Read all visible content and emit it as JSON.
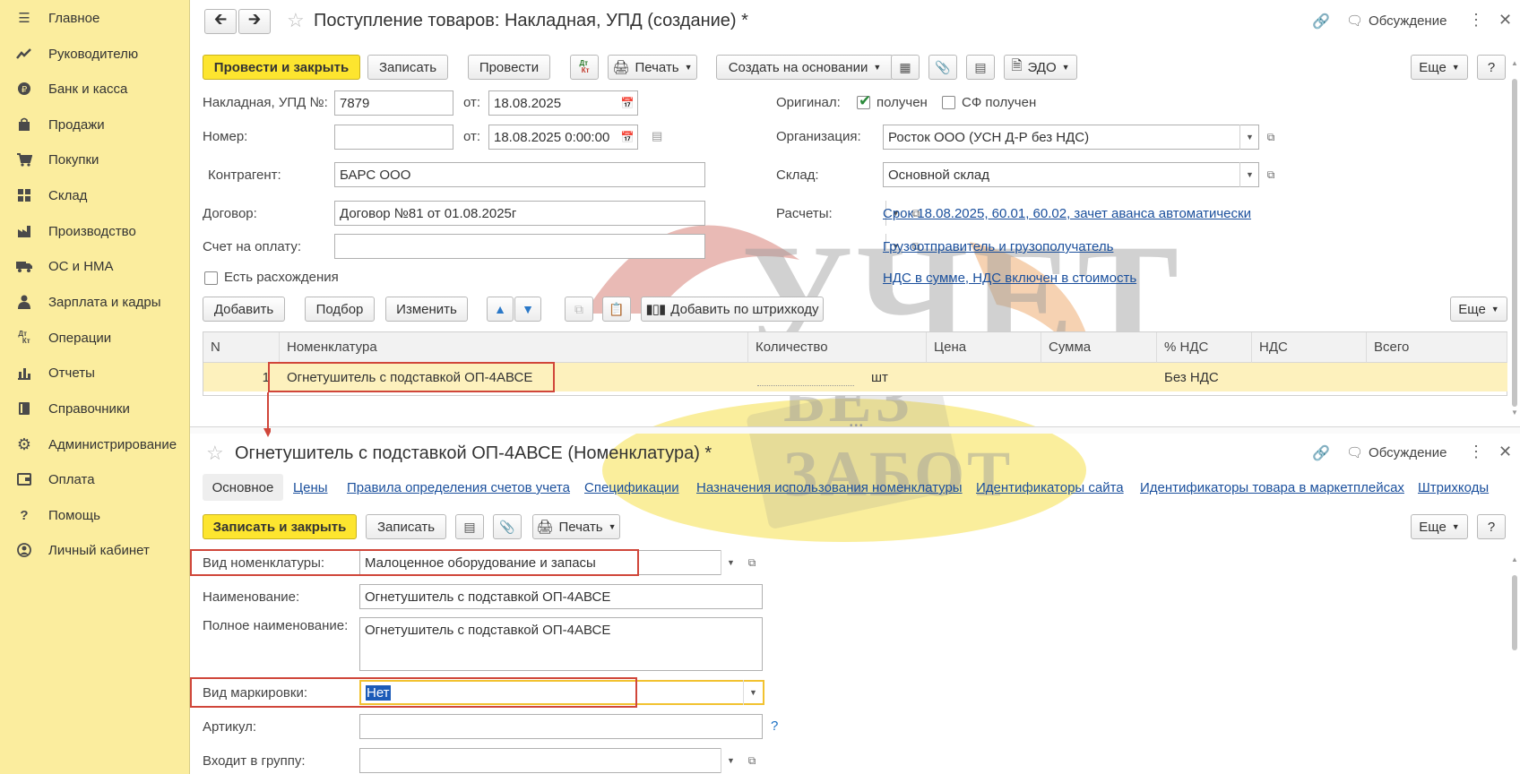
{
  "sidebar": {
    "items": [
      {
        "label": "Главное",
        "icon": "menu-icon"
      },
      {
        "label": "Руководителю",
        "icon": "trend-icon"
      },
      {
        "label": "Банк и касса",
        "icon": "coin-icon"
      },
      {
        "label": "Продажи",
        "icon": "bag-icon"
      },
      {
        "label": "Покупки",
        "icon": "cart-icon"
      },
      {
        "label": "Склад",
        "icon": "warehouse-icon"
      },
      {
        "label": "Производство",
        "icon": "factory-icon"
      },
      {
        "label": "ОС и НМА",
        "icon": "truck-icon"
      },
      {
        "label": "Зарплата и кадры",
        "icon": "person-icon"
      },
      {
        "label": "Операции",
        "icon": "dt-kt-icon"
      },
      {
        "label": "Отчеты",
        "icon": "bar-chart-icon"
      },
      {
        "label": "Справочники",
        "icon": "book-icon"
      },
      {
        "label": "Администрирование",
        "icon": "gear-icon"
      },
      {
        "label": "Оплата",
        "icon": "wallet-icon"
      },
      {
        "label": "Помощь",
        "icon": "question-icon"
      },
      {
        "label": "Личный кабинет",
        "icon": "user-circle-icon"
      }
    ]
  },
  "doc": {
    "title": "Поступление товаров: Накладная, УПД (создание) *",
    "discussion": "Обсуждение",
    "toolbar": {
      "post_close": "Провести и закрыть",
      "save": "Записать",
      "post": "Провести",
      "dtkt": "Дт Кт",
      "print": "Печать",
      "create_based": "Создать на основании",
      "edo": "ЭДО",
      "more": "Еще",
      "help": "?"
    },
    "fields": {
      "invoice_label": "Накладная, УПД №:",
      "invoice_value": "7879",
      "from_label": "от:",
      "invoice_date": "18.08.2025",
      "number_label": "Номер:",
      "number_value": "",
      "from_label2": "от:",
      "number_date": "18.08.2025  0:00:00",
      "contractor_label": "Контрагент:",
      "contractor_value": "БАРС ООО",
      "contract_label": "Договор:",
      "contract_value": "Договор №81 от 01.08.2025г",
      "payment_label": "Счет на оплату:",
      "payment_value": "",
      "discrepancy_label": "Есть расхождения",
      "original_label": "Оригинал:",
      "received_label": "получен",
      "sf_received_label": "СФ получен",
      "org_label": "Организация:",
      "org_value": "Росток ООО (УСН Д-Р без НДС)",
      "warehouse_label": "Склад:",
      "warehouse_value": "Основной склад",
      "settlements_label": "Расчеты:",
      "settlements_link": "Срок 18.08.2025, 60.01, 60.02, зачет аванса автоматически",
      "shipper_link": "Грузоотправитель и грузополучатель",
      "vat_link": "НДС в сумме, НДС включен в стоимость",
      "help_q": "?"
    },
    "table_toolbar": {
      "add": "Добавить",
      "pick": "Подбор",
      "edit": "Изменить",
      "barcode": "Добавить по штрихкоду",
      "more": "Еще"
    },
    "table": {
      "headers": [
        "N",
        "Номенклатура",
        "Количество",
        "Цена",
        "Сумма",
        "% НДС",
        "НДС",
        "Всего"
      ],
      "rows": [
        {
          "n": "1",
          "item": "Огнетушитель с подставкой ОП-4АВСЕ",
          "qty": "",
          "unit": "шт",
          "price": "",
          "sum": "",
          "vat_rate": "Без НДС",
          "vat": "",
          "total": ""
        }
      ]
    }
  },
  "item_form": {
    "title": "Огнетушитель с подставкой ОП-4АВСЕ (Номенклатура) *",
    "discussion": "Обсуждение",
    "tabs": [
      "Основное",
      "Цены",
      "Правила определения счетов учета",
      "Спецификации",
      "Назначения использования номенклатуры",
      "Идентификаторы сайта",
      "Идентификаторы товара в маркетплейсах",
      "Штрихкоды"
    ],
    "toolbar": {
      "save_close": "Записать и закрыть",
      "save": "Записать",
      "print": "Печать",
      "more": "Еще",
      "help": "?"
    },
    "fields": {
      "type_label": "Вид номенклатуры:",
      "type_value": "Малоценное оборудование и запасы",
      "name_label": "Наименование:",
      "name_value": "Огнетушитель с подставкой ОП-4АВСЕ",
      "fullname_label": "Полное наименование:",
      "fullname_value": "Огнетушитель с подставкой ОП-4АВСЕ",
      "marking_label": "Вид маркировки:",
      "marking_value": "Нет",
      "article_label": "Артикул:",
      "article_value": "",
      "group_label": "Входит в группу:",
      "group_value": "",
      "help_q": "?"
    }
  },
  "watermark": {
    "line1": "УЧЕТ",
    "line2": "БЕЗ ЗАБОТ"
  }
}
